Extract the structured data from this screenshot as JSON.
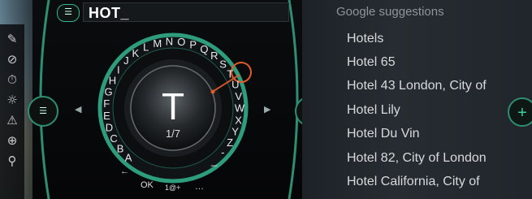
{
  "input": {
    "value": "HOT_"
  },
  "speller": {
    "letters": [
      "A",
      "B",
      "C",
      "D",
      "E",
      "F",
      "G",
      "H",
      "I",
      "J",
      "K",
      "L",
      "M",
      "N",
      "O",
      "P",
      "Q",
      "R",
      "S",
      "T",
      "U",
      "V",
      "W",
      "X",
      "Y",
      "Z"
    ],
    "extra_keys": [
      "-",
      "_"
    ],
    "selected_letter": "T",
    "position_text": "1/7",
    "bottom_keys": {
      "ok": "OK",
      "symbols": "1@+",
      "more": "…",
      "back": "←"
    }
  },
  "suggestions": {
    "title": "Google suggestions",
    "items": [
      "Hotels",
      "Hotel 65",
      "Hotel 43 London, City of",
      "Hotel Lily",
      "Hotel Du Vin",
      "Hotel 82, City of London",
      "Hotel California, City of"
    ]
  },
  "colors": {
    "accent": "#37b58e",
    "selection": "#e05a2a",
    "panel": "#23292e"
  },
  "icons": [
    "speech-pen-icon",
    "crossed-out-icon",
    "stopwatch-icon",
    "sun-icon",
    "warning-icon",
    "target-icon",
    "zoom-in-icon"
  ]
}
